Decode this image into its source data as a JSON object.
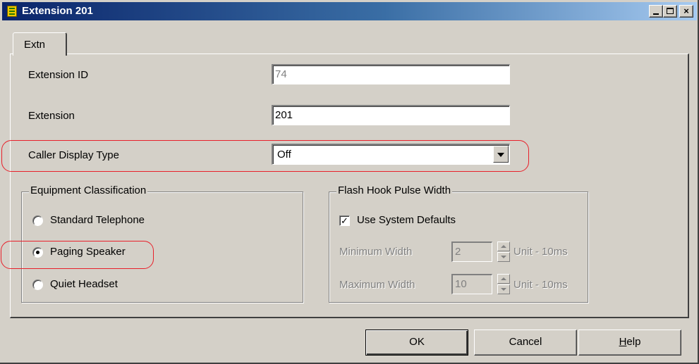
{
  "window": {
    "title": "Extension 201",
    "controls": {
      "minimize": "_",
      "maximize": "□",
      "close": "×"
    }
  },
  "tabs": [
    {
      "label": "Extn",
      "active": true
    }
  ],
  "fields": {
    "extension_id": {
      "label": "Extension ID",
      "value": "74",
      "enabled": false
    },
    "extension": {
      "label": "Extension",
      "value": "201",
      "enabled": true
    },
    "caller_display_type": {
      "label": "Caller Display Type",
      "value": "Off"
    }
  },
  "equipment_classification": {
    "title": "Equipment Classification",
    "options": [
      {
        "label": "Standard Telephone",
        "checked": false
      },
      {
        "label": "Paging Speaker",
        "checked": true
      },
      {
        "label": "Quiet Headset",
        "checked": false
      }
    ]
  },
  "flash_hook": {
    "title": "Flash Hook Pulse Width",
    "use_system_defaults": {
      "label": "Use System Defaults",
      "checked": true
    },
    "minimum": {
      "label": "Minimum Width",
      "value": "2",
      "unit": "Unit - 10ms"
    },
    "maximum": {
      "label": "Maximum Width",
      "value": "10",
      "unit": "Unit - 10ms"
    }
  },
  "buttons": {
    "ok": "OK",
    "cancel": "Cancel",
    "help_first": "H",
    "help_rest": "elp"
  },
  "colors": {
    "highlight": "#e8202a",
    "titlebar_start": "#0a246a",
    "titlebar_end": "#a6caf0"
  }
}
